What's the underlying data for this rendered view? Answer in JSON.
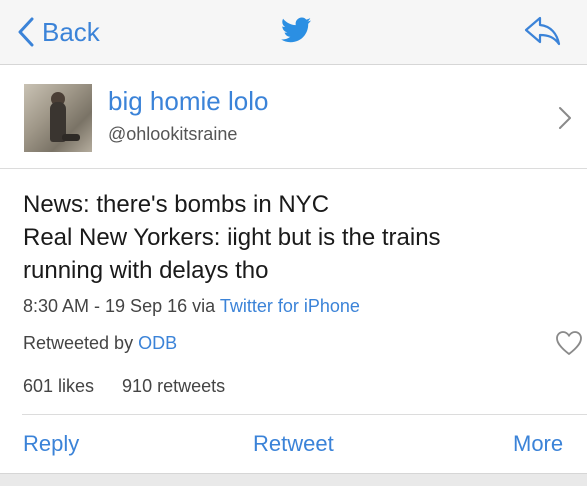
{
  "nav": {
    "back_label": "Back"
  },
  "profile": {
    "display_name": "big homie lolo",
    "handle": "@ohlookitsraine"
  },
  "tweet": {
    "lines": [
      "News: there's bombs in NYC",
      "Real New Yorkers: iight but is the trains",
      "running with delays tho"
    ],
    "timestamp": "8:30 AM - 19 Sep 16",
    "via_prefix": "via",
    "source": "Twitter for iPhone",
    "retweeted_prefix": "Retweeted by",
    "retweeted_by": "ODB",
    "likes": "601 likes",
    "retweets": "910 retweets"
  },
  "actions": {
    "reply": "Reply",
    "retweet": "Retweet",
    "more": "More"
  },
  "colors": {
    "link_blue": "#3b83d8",
    "nav_background": "#f6f6f6"
  },
  "icons": {
    "back": "chevron-left-icon",
    "logo": "twitter-bird-icon",
    "share": "share-arrow-icon",
    "disclosure": "chevron-right-icon",
    "like": "heart-icon"
  }
}
